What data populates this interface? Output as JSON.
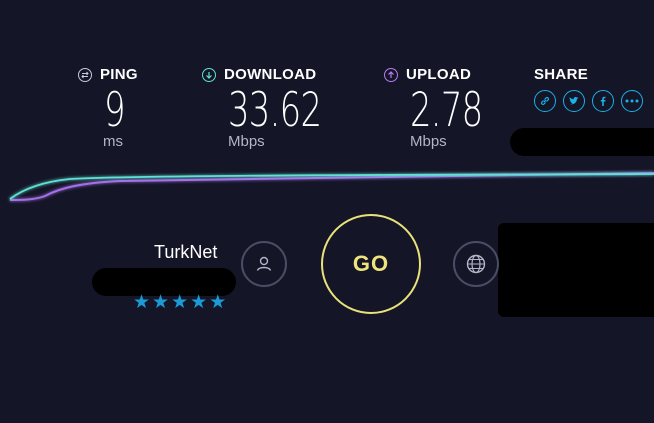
{
  "metrics": {
    "ping": {
      "label": "PING",
      "value": "9",
      "unit": "ms",
      "icon": "ping-icon",
      "color": "#c7c9dc"
    },
    "download": {
      "label": "DOWNLOAD",
      "value": "33.62",
      "unit": "Mbps",
      "icon": "download-arrow-icon",
      "color": "#5fe2d4"
    },
    "upload": {
      "label": "UPLOAD",
      "value": "2.78",
      "unit": "Mbps",
      "icon": "upload-arrow-icon",
      "color": "#b77cf0"
    }
  },
  "share": {
    "label": "SHARE",
    "buttons": [
      "link-icon",
      "twitter-icon",
      "facebook-icon",
      "more-icon"
    ],
    "color": "#1ab0e8"
  },
  "provider": {
    "name": "TurkNet",
    "rating_stars": 5
  },
  "go_button": {
    "label": "GO",
    "color": "#efe47c"
  },
  "colors": {
    "background": "#141526",
    "download_line": "#5fe2d4",
    "upload_line": "#a46fe8"
  }
}
